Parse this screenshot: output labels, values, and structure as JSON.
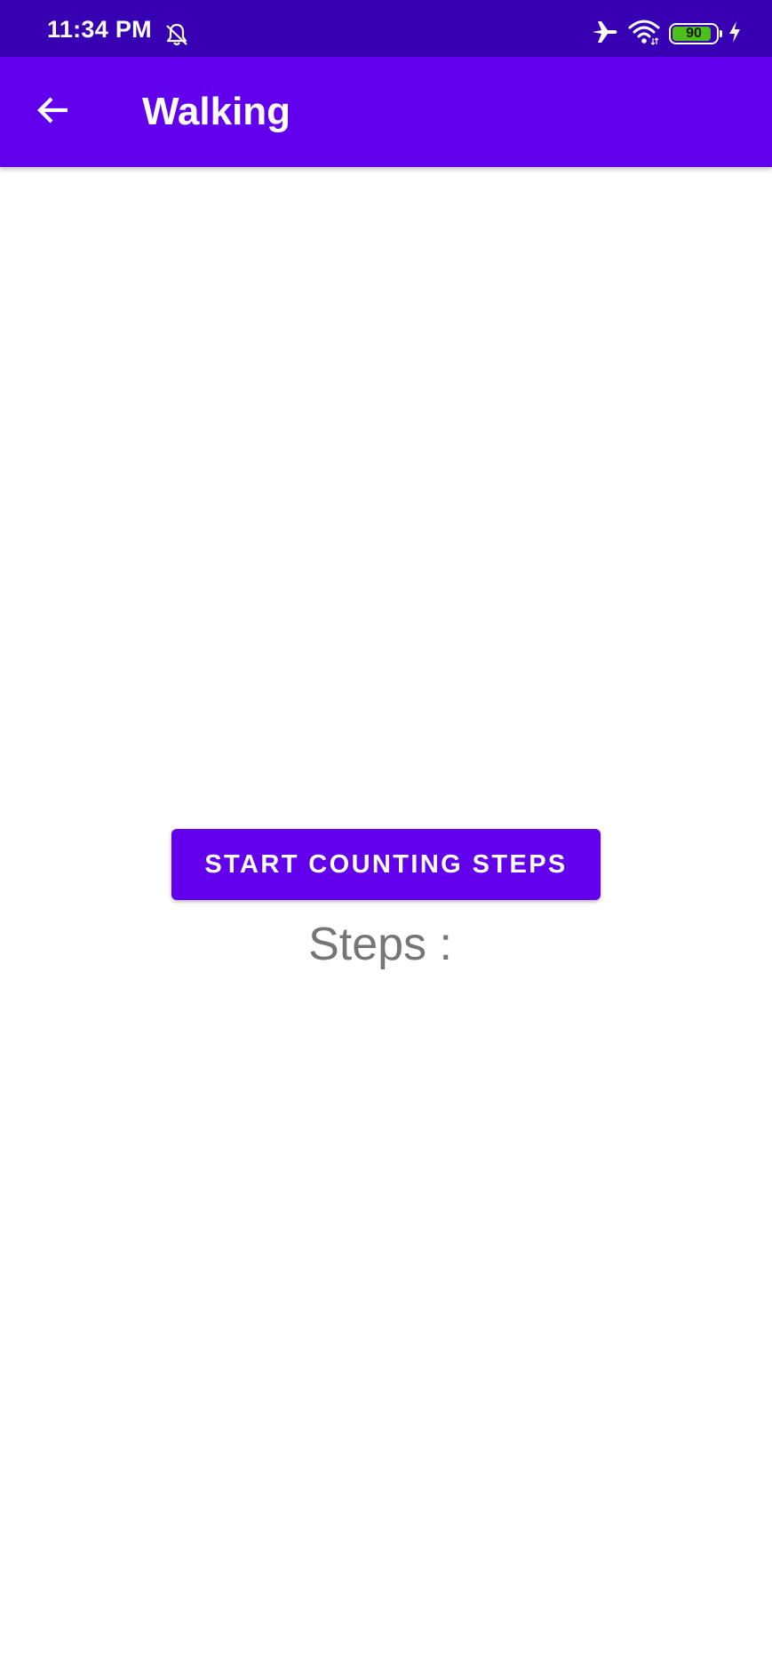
{
  "status_bar": {
    "time": "11:34 PM",
    "icons": [
      "silent-bell-icon",
      "airplane-icon",
      "wifi-icon",
      "battery-icon",
      "charging-icon"
    ],
    "battery_level": "90",
    "battery_fraction": 0.9,
    "battery_color": "#4cc11a"
  },
  "app_bar": {
    "title": "Walking",
    "back_icon": "arrow-back-icon",
    "color": "#6200ee"
  },
  "main": {
    "start_button_label": "START COUNTING STEPS",
    "steps_label": "Steps :"
  },
  "colors": {
    "status_bar": "#3700b3",
    "primary": "#6200ee",
    "text_secondary": "#757575"
  }
}
